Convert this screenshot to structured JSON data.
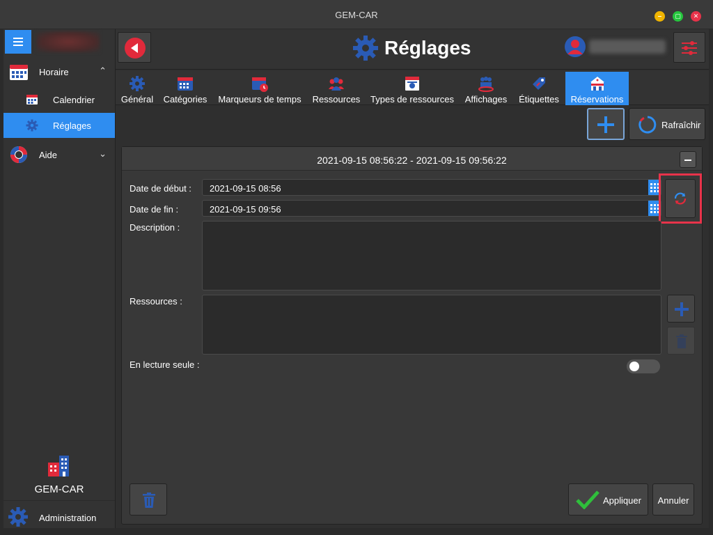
{
  "window": {
    "title": "GEM-CAR"
  },
  "colors": {
    "accent": "#2f8df0",
    "danger": "#e12a3b",
    "success": "#2fbf3b",
    "highlight": "#e8334a",
    "icon_blue": "#2a5bb5"
  },
  "sidebar": {
    "menu_icon": "hamburger-icon",
    "items": [
      {
        "label": "Horaire",
        "icon": "calendar-icon",
        "chevron": "⌃"
      },
      {
        "label": "Calendrier",
        "icon": "calendar-small-icon"
      },
      {
        "label": "Réglages",
        "icon": "gear-icon"
      },
      {
        "label": "Aide",
        "icon": "lifebuoy-icon",
        "chevron": "⌄"
      }
    ],
    "brand_name": "GEM-CAR",
    "admin_label": "Administration"
  },
  "header": {
    "title": "Réglages",
    "back_icon": "back-arrow-icon",
    "user_icon": "user-icon",
    "settings_icon": "sliders-icon"
  },
  "tabs": [
    {
      "label": "Général",
      "icon": "gear-icon"
    },
    {
      "label": "Catégories",
      "icon": "calendar-icon"
    },
    {
      "label": "Marqueurs de temps",
      "icon": "calendar-clock-icon"
    },
    {
      "label": "Ressources",
      "icon": "people-icon"
    },
    {
      "label": "Types de ressources",
      "icon": "resource-type-icon"
    },
    {
      "label": "Affichages",
      "icon": "display-icon"
    },
    {
      "label": "Étiquettes",
      "icon": "tag-icon"
    },
    {
      "label": "Réservations",
      "icon": "reservation-icon",
      "active": true
    }
  ],
  "toolbar": {
    "refresh_label": "Rafraîchir"
  },
  "panel": {
    "title": "2021-09-15 08:56:22 - 2021-09-15 09:56:22",
    "start_label": "Date de début :",
    "start_value": "2021-09-15 08:56",
    "end_label": "Date de fin :",
    "end_value": "2021-09-15 09:56",
    "description_label": "Description :",
    "resources_label": "Ressources :",
    "readonly_label": "En lecture seule :",
    "readonly_value": false
  },
  "footer": {
    "apply_label": "Appliquer",
    "cancel_label": "Annuler"
  }
}
